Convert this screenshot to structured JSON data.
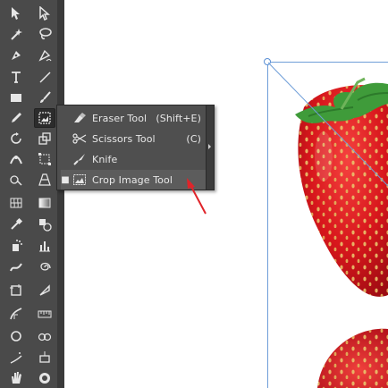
{
  "toolbar": {
    "tools": [
      {
        "left_icon": "selection-arrow-icon",
        "right_icon": "direct-selection-arrow-icon"
      },
      {
        "left_icon": "magic-wand-icon",
        "right_icon": "lasso-icon"
      },
      {
        "left_icon": "pen-icon",
        "right_icon": "curvature-pen-icon"
      },
      {
        "left_icon": "type-icon",
        "right_icon": "line-segment-icon"
      },
      {
        "left_icon": "rectangle-icon",
        "right_icon": "paintbrush-icon"
      },
      {
        "left_icon": "pencil-icon",
        "right_icon": "crop-image-tool-icon"
      },
      {
        "left_icon": "rotate-icon",
        "right_icon": "scale-icon"
      },
      {
        "left_icon": "width-icon",
        "right_icon": "free-transform-icon"
      },
      {
        "left_icon": "shape-builder-icon",
        "right_icon": "perspective-grid-icon"
      },
      {
        "left_icon": "mesh-icon",
        "right_icon": "gradient-icon"
      },
      {
        "left_icon": "eyedropper-icon",
        "right_icon": "blend-icon"
      },
      {
        "left_icon": "symbol-sprayer-icon",
        "right_icon": "column-graph-icon"
      },
      {
        "left_icon": "warp-icon",
        "right_icon": "twirl-icon"
      },
      {
        "left_icon": "artboard-icon",
        "right_icon": "slice-icon"
      },
      {
        "left_icon": "pucker-icon",
        "right_icon": "ruler-icon"
      },
      {
        "left_icon": "ellipse-icon",
        "right_icon": "star-icon"
      },
      {
        "left_icon": "sprayer-icon",
        "right_icon": "bloat-icon"
      },
      {
        "left_icon": "hand-icon",
        "right_icon": "zoom-icon"
      }
    ]
  },
  "flyout": {
    "items": [
      {
        "label": "Eraser Tool",
        "shortcut": "(Shift+E)",
        "icon": "eraser-icon",
        "selected": false
      },
      {
        "label": "Scissors Tool",
        "shortcut": "(C)",
        "icon": "scissors-icon",
        "selected": false
      },
      {
        "label": "Knife",
        "shortcut": "",
        "icon": "knife-icon",
        "selected": false
      },
      {
        "label": "Crop Image Tool",
        "shortcut": "",
        "icon": "crop-image-icon",
        "selected": true,
        "bullet": "■"
      }
    ]
  },
  "annotation": {
    "arrow_color": "#e0242a"
  },
  "canvas": {
    "selection_color": "#6f9ed8",
    "subject": "strawberry-image"
  }
}
